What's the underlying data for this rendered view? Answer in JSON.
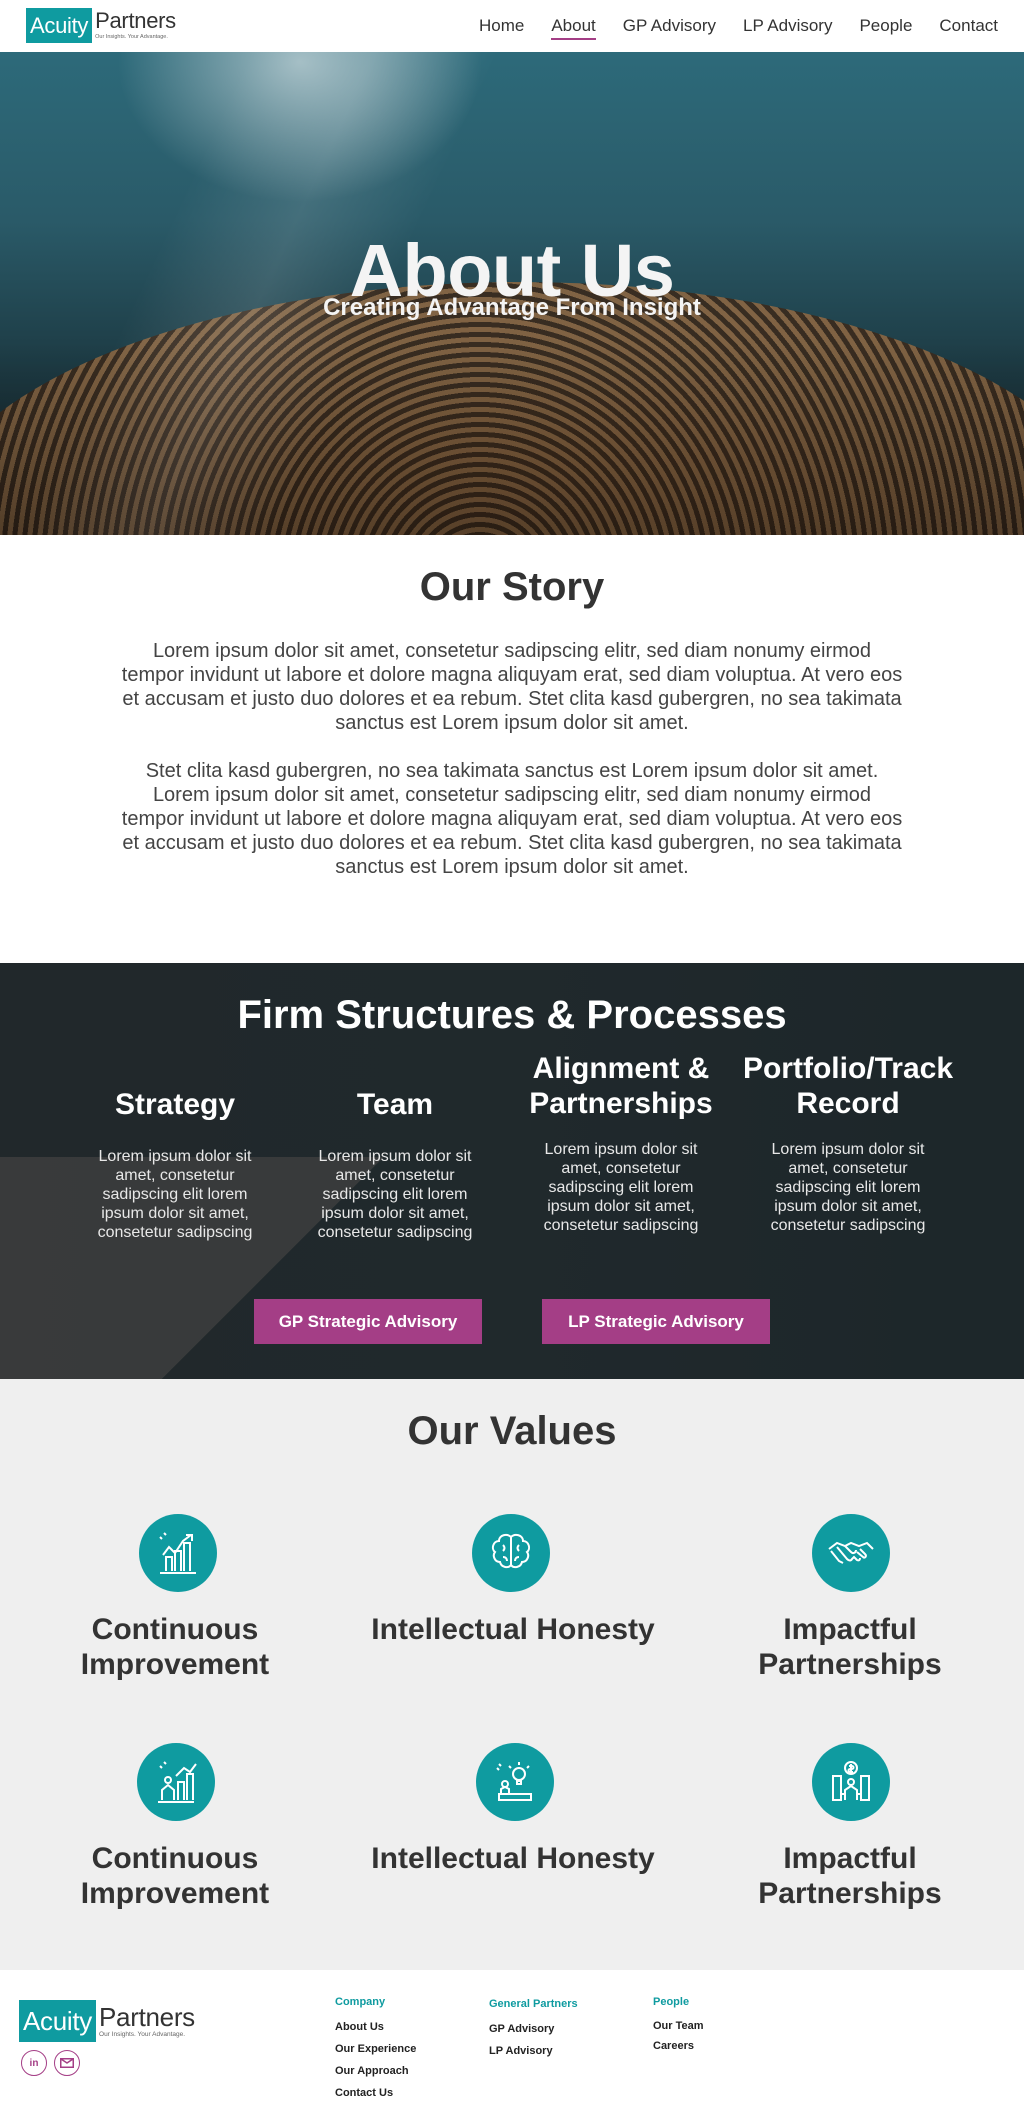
{
  "brand": {
    "name_box": "Acuity",
    "name": "Partners",
    "tagline": "Our Insights. Your Advantage.",
    "accent": "#0f9ba0",
    "button": "#a43e86"
  },
  "nav": {
    "items": [
      "Home",
      "About",
      "GP Advisory",
      "LP Advisory",
      "People",
      "Contact"
    ],
    "active": "About"
  },
  "hero": {
    "title": "About Us",
    "subtitle": "Creating Advantage From Insight"
  },
  "story": {
    "title": "Our Story",
    "p1": "Lorem ipsum dolor sit amet, consetetur sadipscing elitr, sed diam nonumy eirmod tempor invidunt ut labore et dolore magna aliquyam erat, sed diam voluptua. At vero eos et accusam et justo duo dolores et ea rebum. Stet clita kasd gubergren, no sea takimata sanctus est Lorem ipsum dolor sit amet.",
    "p2": "Stet clita kasd gubergren, no sea takimata sanctus est Lorem ipsum dolor sit amet. Lorem ipsum dolor sit amet, consetetur sadipscing elitr, sed diam nonumy eirmod tempor invidunt ut labore et dolore magna aliquyam erat, sed diam voluptua. At vero eos et accusam et justo duo dolores et ea rebum. Stet clita kasd gubergren, no sea takimata sanctus est Lorem ipsum dolor sit amet."
  },
  "firm": {
    "title": "Firm Structures & Processes",
    "columns": [
      {
        "title": "Strategy",
        "text": "Lorem ipsum dolor sit amet, consetetur sadipscing elit lorem ipsum dolor sit amet, consetetur sadipscing"
      },
      {
        "title": "Team",
        "text": "Lorem ipsum dolor sit amet, consetetur sadipscing elit lorem ipsum dolor sit amet, consetetur sadipscing"
      },
      {
        "title": "Alignment & Partnerships",
        "text": "Lorem ipsum dolor sit amet, consetetur sadipscing elit lorem ipsum dolor sit amet, consetetur sadipscing"
      },
      {
        "title": "Portfolio/Track Record",
        "text": "Lorem ipsum dolor sit amet, consetetur sadipscing elit lorem ipsum dolor sit amet, consetetur sadipscing"
      }
    ],
    "buttons": [
      "GP Strategic Advisory",
      "LP Strategic Advisory"
    ]
  },
  "values": {
    "title": "Our Values",
    "items": [
      {
        "title": "Continuous Improvement",
        "icon": "growth-arrows-icon"
      },
      {
        "title": "Intellectual Honesty",
        "icon": "brain-icon"
      },
      {
        "title": "Impactful Partnerships",
        "icon": "handshake-icon"
      },
      {
        "title": "Continuous Improvement",
        "icon": "growth-person-icon"
      },
      {
        "title": "Intellectual Honesty",
        "icon": "idea-desk-icon"
      },
      {
        "title": "Impactful Partnerships",
        "icon": "dollar-person-icon"
      }
    ]
  },
  "footer": {
    "social": [
      "linkedin-icon",
      "mail-icon"
    ],
    "linkedin_label": "in",
    "company": {
      "head": "Company",
      "links": [
        "About Us",
        "Our Experience",
        "Our Approach",
        "Contact Us"
      ]
    },
    "gp": {
      "head": "General Partners",
      "links": [
        "GP Advisory",
        "LP Advisory"
      ]
    },
    "people": {
      "head": "People",
      "links": [
        "Our Team",
        "Careers"
      ]
    }
  }
}
